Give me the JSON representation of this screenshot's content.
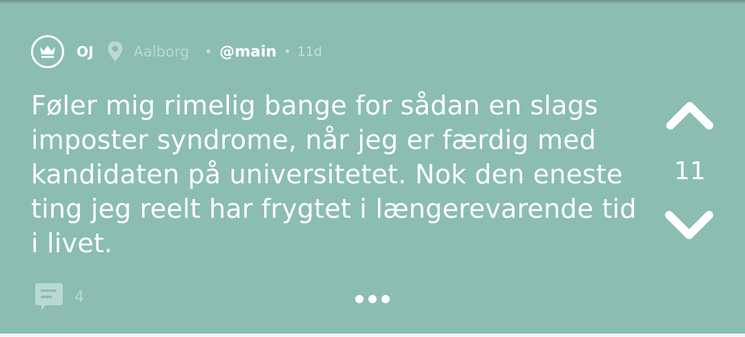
{
  "post": {
    "author": "OJ",
    "location": "Aalborg",
    "separator": "•",
    "channel": "@main",
    "time": "11d",
    "text": "Føler mig rimelig bange for sådan en slags imposter syndrome, når jeg er færdig med kandidaten på universitetet. Nok den eneste ting jeg reelt har frygtet i længerevarende tid i livet.",
    "votes": "11",
    "comment_count": "4"
  },
  "icons": {
    "avatar": "crown-icon",
    "location": "map-pin-icon",
    "upvote": "chevron-up-icon",
    "downvote": "chevron-down-icon",
    "comments": "comment-bubble-icon",
    "more": "more-dots-icon"
  },
  "colors": {
    "background": "#8bbdb1",
    "text": "#ffffff",
    "muted": "#b9d9d1"
  }
}
